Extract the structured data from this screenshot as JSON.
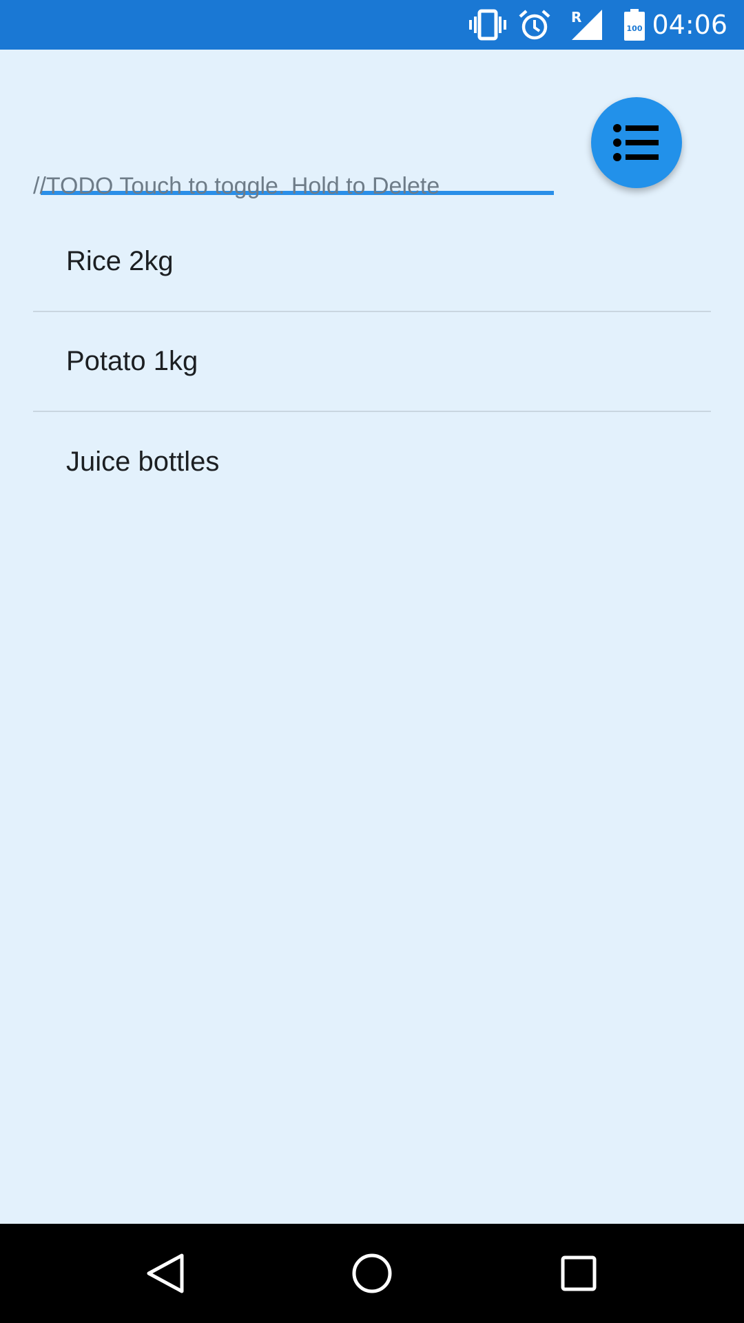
{
  "status_bar": {
    "time": "04:06",
    "network_indicator": "R",
    "battery_level": "100",
    "icons": [
      "vibrate-icon",
      "alarm-icon",
      "signal-icon",
      "battery-icon"
    ]
  },
  "input": {
    "value": "",
    "placeholder": ""
  },
  "fab": {
    "icon": "list-icon"
  },
  "hint": "//TODO Touch to toggle. Hold to Delete",
  "todos": [
    {
      "text": "Rice 2kg"
    },
    {
      "text": "Potato 1kg"
    },
    {
      "text": "Juice bottles"
    }
  ],
  "nav": {
    "icons": [
      "back-icon",
      "home-icon",
      "recents-icon"
    ]
  },
  "colors": {
    "status_bar": "#1A78D4",
    "background": "#E3F1FC",
    "accent": "#2291EA",
    "nav_bar": "#000000"
  }
}
